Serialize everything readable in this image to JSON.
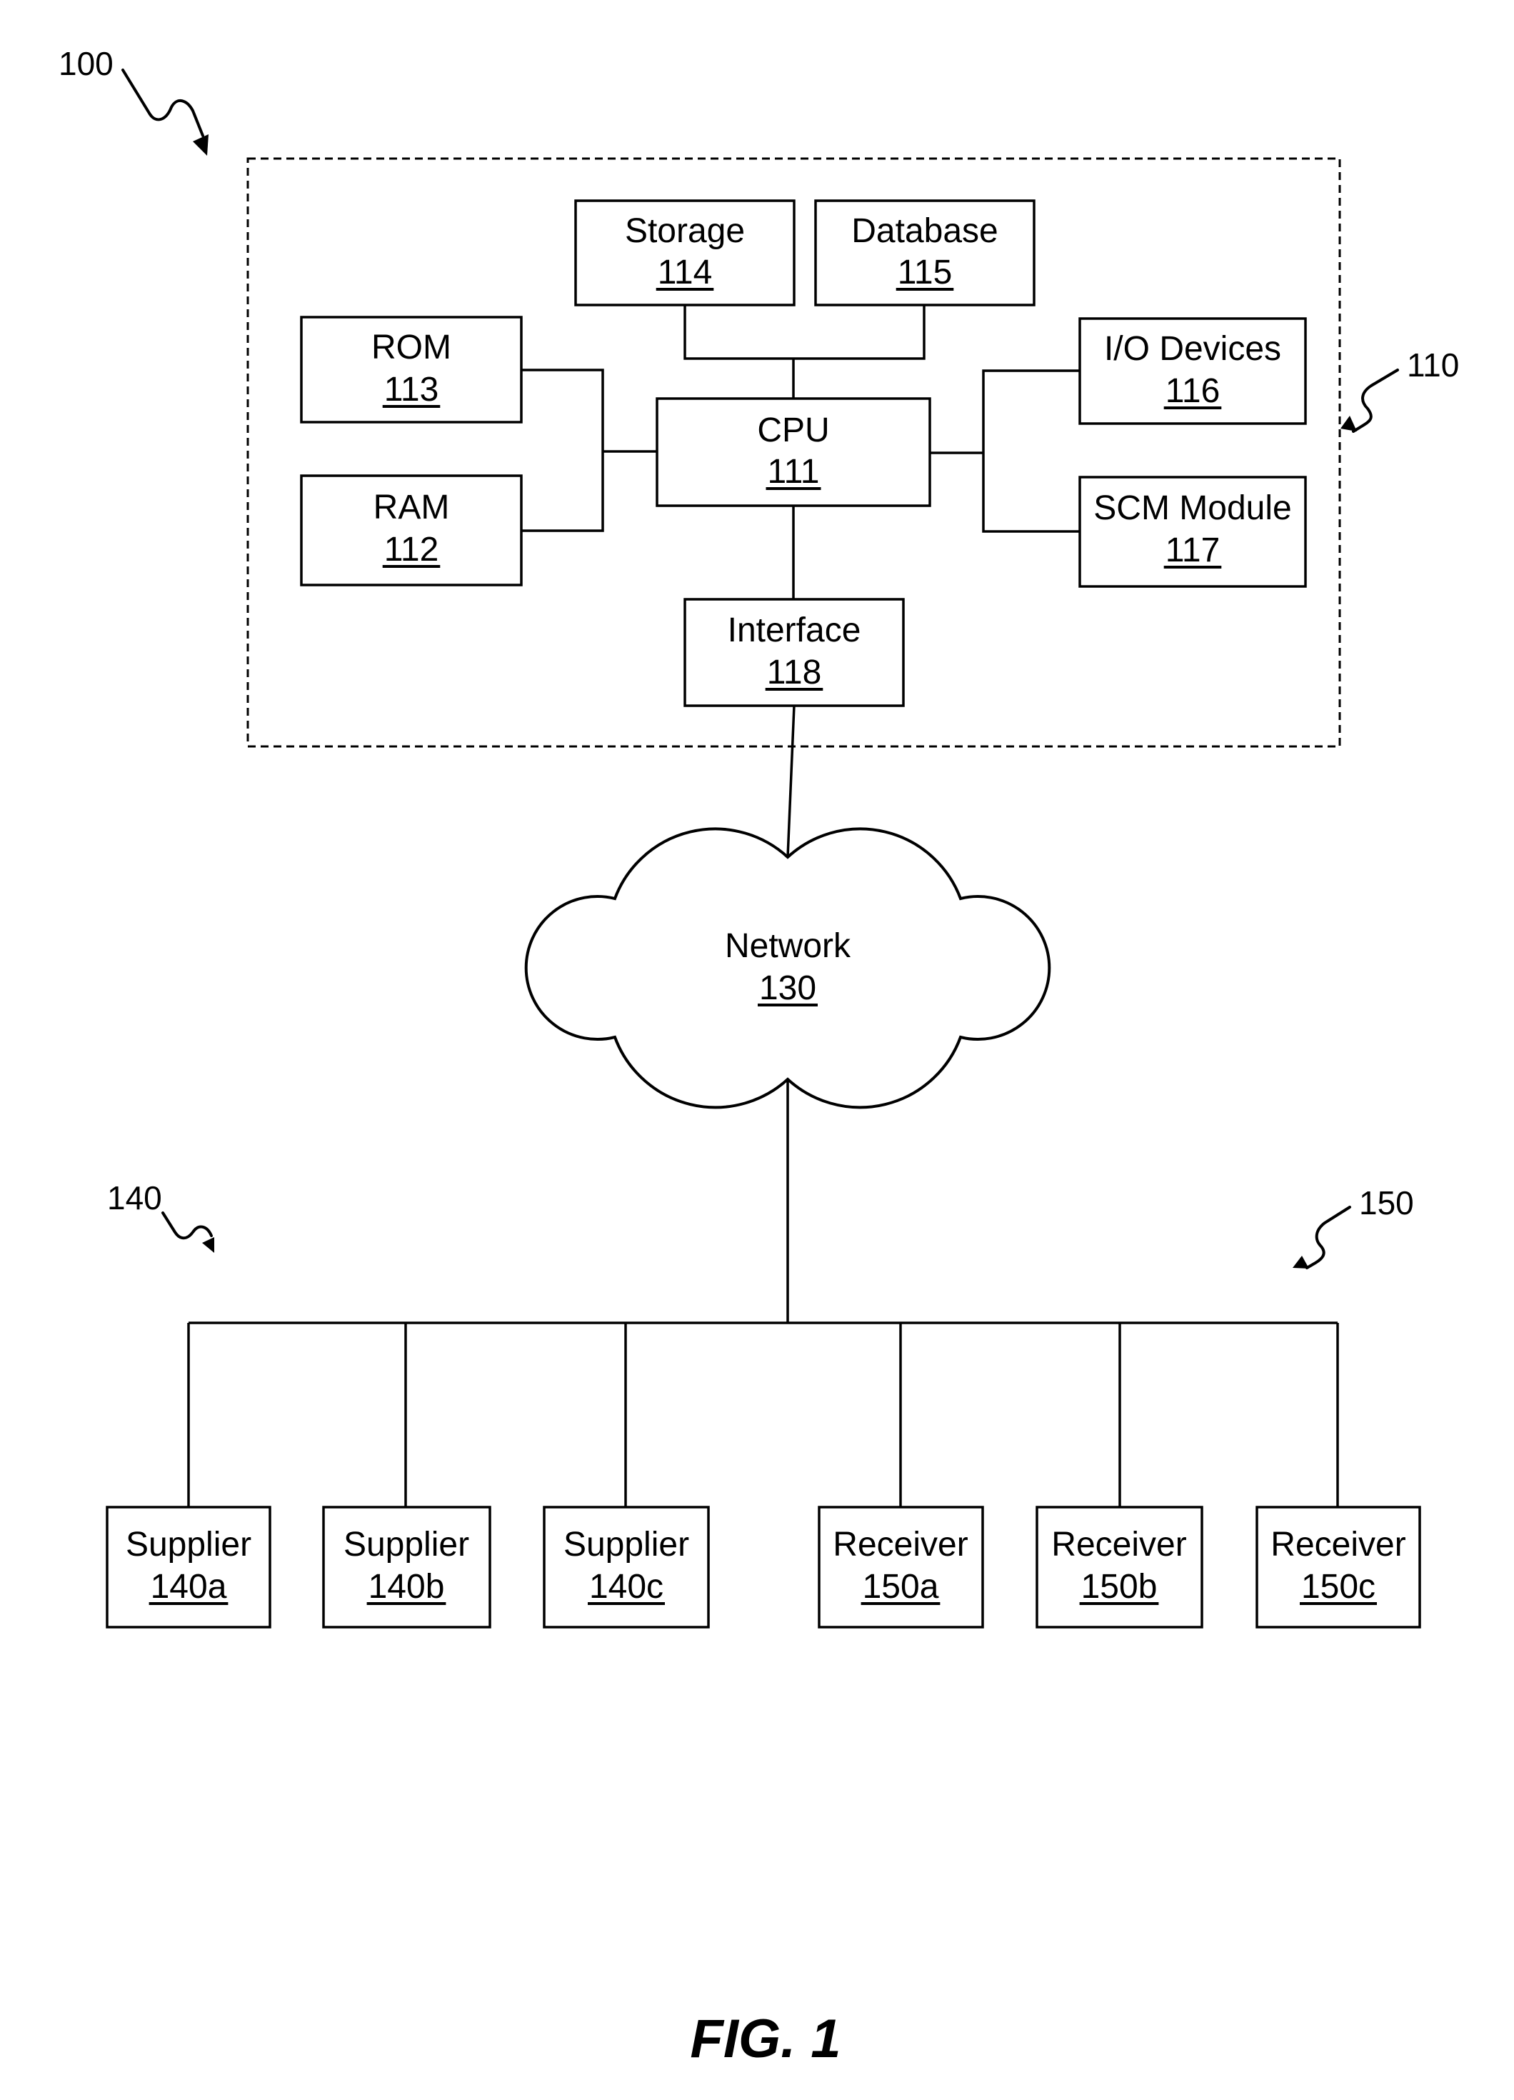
{
  "figure": {
    "caption": "FIG. 1",
    "reference_labels": {
      "system": "100",
      "computer": "110",
      "suppliers": "140",
      "receivers": "150"
    }
  },
  "computer_system": {
    "components": {
      "cpu": {
        "name": "CPU",
        "ref": "111"
      },
      "ram": {
        "name": "RAM",
        "ref": "112"
      },
      "rom": {
        "name": "ROM",
        "ref": "113"
      },
      "storage": {
        "name": "Storage",
        "ref": "114"
      },
      "database": {
        "name": "Database",
        "ref": "115"
      },
      "io_devices": {
        "name": "I/O Devices",
        "ref": "116"
      },
      "scm_module": {
        "name": "SCM Module",
        "ref": "117"
      },
      "interface": {
        "name": "Interface",
        "ref": "118"
      }
    }
  },
  "network": {
    "name": "Network",
    "ref": "130"
  },
  "suppliers": [
    {
      "name": "Supplier",
      "ref": "140a"
    },
    {
      "name": "Supplier",
      "ref": "140b"
    },
    {
      "name": "Supplier",
      "ref": "140c"
    }
  ],
  "receivers": [
    {
      "name": "Receiver",
      "ref": "150a"
    },
    {
      "name": "Receiver",
      "ref": "150b"
    },
    {
      "name": "Receiver",
      "ref": "150c"
    }
  ]
}
